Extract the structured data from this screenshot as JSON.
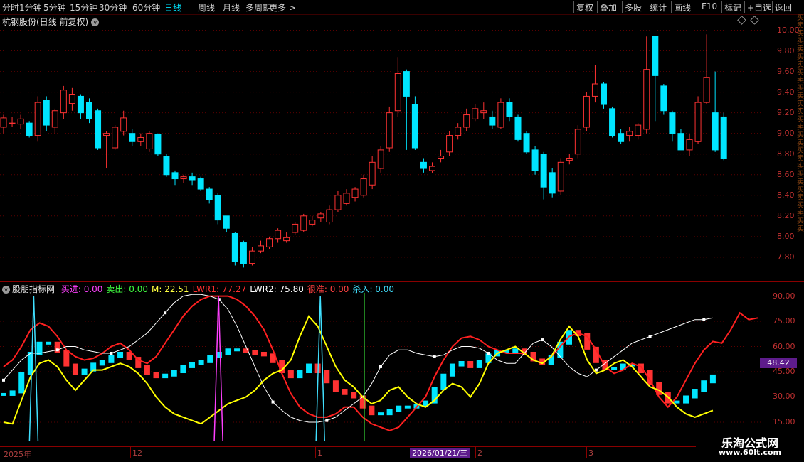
{
  "periods": [
    {
      "label": "分时",
      "active": false
    },
    {
      "label": "1分钟",
      "active": false
    },
    {
      "label": "5分钟",
      "active": false
    },
    {
      "label": "15分钟",
      "active": false
    },
    {
      "label": "30分钟",
      "active": false
    },
    {
      "label": "60分钟",
      "active": false
    },
    {
      "label": "日线",
      "active": true
    },
    {
      "label": "周线",
      "active": false
    },
    {
      "label": "月线",
      "active": false
    },
    {
      "label": "多周期",
      "active": false
    },
    {
      "label": "更多 >",
      "active": false
    }
  ],
  "toolbar": [
    "复权",
    "叠加",
    "多股",
    "统计",
    "画线",
    "F10",
    "标记",
    "+自选",
    "返回"
  ],
  "stock": {
    "title": "杭钢股份(日线 前复权)"
  },
  "price_axis": {
    "ticks": [
      "10.00",
      "9.80",
      "9.60",
      "9.40",
      "9.20",
      "9.00",
      "8.80",
      "8.60",
      "8.40",
      "8.20",
      "8.00",
      "7.80"
    ],
    "ylim": [
      7.62,
      10.1
    ]
  },
  "indicator": {
    "name": "股朋指标网",
    "items": [
      {
        "label": "买进: 0.00",
        "color": "#ff40ff"
      },
      {
        "label": "卖出: 0.00",
        "color": "#40ff40"
      },
      {
        "label": "M: 22.51",
        "color": "#ffff40"
      },
      {
        "label": "LWR1: 77.27",
        "color": "#ff3030"
      },
      {
        "label": "LWR2: 75.80",
        "color": "#ffffff"
      },
      {
        "label": "很准: 0.00",
        "color": "#ff4040"
      },
      {
        "label": "杀入: 0.00",
        "color": "#40e0ff"
      }
    ],
    "ticks": [
      "90.00",
      "75.00",
      "60.00",
      "45.00",
      "30.00",
      "15.00"
    ],
    "ylim": [
      4,
      97
    ],
    "current_value": "48.42"
  },
  "right_strip_text": "买卖实买卖买卖买卖买卖实实买卖买卖买卖实买卖买卖买卖买卖",
  "dates": [
    {
      "label": "2025年"
    },
    {
      "label": "12"
    },
    {
      "label": "1"
    },
    {
      "label": "2"
    },
    {
      "label": "3"
    }
  ],
  "cursor_date": "2026/01/21/三",
  "watermark": {
    "line1": "乐淘公式网",
    "line2": "www.60lt.com"
  },
  "colors": {
    "up": "#ff3232",
    "down": "#00e5ff",
    "lwr1": "#ff2020",
    "lwr2": "#ffffff",
    "m": "#ffff00",
    "buy": "#ff40ff",
    "kill": "#40e0ff",
    "grid": "#5a0000"
  },
  "chart_data": [
    {
      "type": "candlestick",
      "title": "杭钢股份(日线 前复权)",
      "x": [
        "d01",
        "d02",
        "d03",
        "d04",
        "d05",
        "d06",
        "d07",
        "d08",
        "d09",
        "d10",
        "d11",
        "d12",
        "d13",
        "d14",
        "d15",
        "d16",
        "d17",
        "d18",
        "d19",
        "d20",
        "d21",
        "d22",
        "d23",
        "d24",
        "d25",
        "d26",
        "d27",
        "d28",
        "d29",
        "d30",
        "d31",
        "d32",
        "d33",
        "d34",
        "d35",
        "d36",
        "d37",
        "d38",
        "d39",
        "d40",
        "d41",
        "d42",
        "d43",
        "d44",
        "d45",
        "d46",
        "d47",
        "d48",
        "d49",
        "d50",
        "d51",
        "d52",
        "d53",
        "d54",
        "d55",
        "d56",
        "d57",
        "d58",
        "d59",
        "d60",
        "d61",
        "d62",
        "d63",
        "d64",
        "d65",
        "d66",
        "d67",
        "d68",
        "d69",
        "d70",
        "d71",
        "d72",
        "d73",
        "d74",
        "d75",
        "d76",
        "d77",
        "d78",
        "d79",
        "d80",
        "d81",
        "d82",
        "d83",
        "d84",
        "d85"
      ],
      "open": [
        9.06,
        9.1,
        9.09,
        9.1,
        8.98,
        9.32,
        9.06,
        9.2,
        9.29,
        9.36,
        9.3,
        9.22,
        8.98,
        8.86,
        9.02,
        9.0,
        8.92,
        8.85,
        8.99,
        8.78,
        8.62,
        8.56,
        8.58,
        8.56,
        8.46,
        8.4,
        8.2,
        8.03,
        7.94,
        7.74,
        7.86,
        7.9,
        7.98,
        7.96,
        8.04,
        8.06,
        8.12,
        8.18,
        8.14,
        8.26,
        8.32,
        8.38,
        8.4,
        8.5,
        8.66,
        8.86,
        9.22,
        9.6,
        9.28,
        8.72,
        8.64,
        8.76,
        8.82,
        8.98,
        9.06,
        9.14,
        9.2,
        9.16,
        9.06,
        9.3,
        9.16,
        9.0,
        8.84,
        8.8,
        8.62,
        8.44,
        8.74,
        8.8,
        9.06,
        9.36,
        9.48,
        9.24,
        9.0,
        8.98,
        8.98,
        9.04,
        9.94,
        9.46,
        9.2,
        9.0,
        8.84,
        8.92,
        9.3,
        9.2,
        9.16
      ],
      "close": [
        9.15,
        9.1,
        9.14,
        8.98,
        9.3,
        9.08,
        9.22,
        9.42,
        9.38,
        9.2,
        9.14,
        8.86,
        9.0,
        9.06,
        9.15,
        8.92,
        8.96,
        9.0,
        8.8,
        8.6,
        8.56,
        8.58,
        8.55,
        8.46,
        8.36,
        8.16,
        8.08,
        7.76,
        7.74,
        7.86,
        7.91,
        7.98,
        8.06,
        7.99,
        8.12,
        8.2,
        8.16,
        8.22,
        8.26,
        8.4,
        8.42,
        8.46,
        8.56,
        8.72,
        8.84,
        9.2,
        9.58,
        9.36,
        8.86,
        8.66,
        8.68,
        8.78,
        8.98,
        9.06,
        9.18,
        9.24,
        9.22,
        9.08,
        9.3,
        9.16,
        8.94,
        8.82,
        8.64,
        8.48,
        8.42,
        8.72,
        8.76,
        9.04,
        9.36,
        9.48,
        9.28,
        8.98,
        8.92,
        9.02,
        9.08,
        9.62,
        9.56,
        9.22,
        9.0,
        8.84,
        8.94,
        9.3,
        9.54,
        8.84,
        8.76
      ],
      "high": [
        9.18,
        9.16,
        9.18,
        9.12,
        9.36,
        9.36,
        9.24,
        9.46,
        9.44,
        9.38,
        9.34,
        9.24,
        9.02,
        9.08,
        9.22,
        9.04,
        9.0,
        9.02,
        9.0,
        8.8,
        8.64,
        8.6,
        8.62,
        8.58,
        8.48,
        8.42,
        8.2,
        8.04,
        7.96,
        7.9,
        7.96,
        8.0,
        8.08,
        8.04,
        8.14,
        8.22,
        8.2,
        8.24,
        8.3,
        8.44,
        8.46,
        8.48,
        8.6,
        8.78,
        8.88,
        9.26,
        9.74,
        9.62,
        9.36,
        8.76,
        8.72,
        8.84,
        9.02,
        9.1,
        9.24,
        9.28,
        9.3,
        9.22,
        9.34,
        9.34,
        9.18,
        9.02,
        8.88,
        8.82,
        8.66,
        8.76,
        8.8,
        9.08,
        9.4,
        9.66,
        9.5,
        9.26,
        9.04,
        9.06,
        9.1,
        9.94,
        9.6,
        9.48,
        9.22,
        9.04,
        9.0,
        9.36,
        9.96,
        9.6,
        9.2
      ],
      "low": [
        9.0,
        9.06,
        9.04,
        8.96,
        8.92,
        9.02,
        9.0,
        9.14,
        9.22,
        9.14,
        9.1,
        8.84,
        8.66,
        8.84,
        8.98,
        8.88,
        8.88,
        8.82,
        8.78,
        8.58,
        8.5,
        8.52,
        8.5,
        8.44,
        8.32,
        8.12,
        8.04,
        7.72,
        7.7,
        7.72,
        7.84,
        7.88,
        7.94,
        7.94,
        8.02,
        8.04,
        8.1,
        8.14,
        8.12,
        8.24,
        8.3,
        8.34,
        8.38,
        8.46,
        8.62,
        8.82,
        9.16,
        8.84,
        8.84,
        8.62,
        8.62,
        8.72,
        8.78,
        8.94,
        9.02,
        9.12,
        9.14,
        9.04,
        9.04,
        9.12,
        8.92,
        8.8,
        8.6,
        8.36,
        8.38,
        8.4,
        8.7,
        8.76,
        9.02,
        9.3,
        9.24,
        8.96,
        8.9,
        8.92,
        8.94,
        9.0,
        9.12,
        9.18,
        8.92,
        8.84,
        8.78,
        8.9,
        9.28,
        8.82,
        8.74
      ]
    },
    {
      "type": "line",
      "title": "股朋指标网",
      "x_count": 85,
      "series": [
        {
          "name": "LWR1",
          "values": [
            48,
            52,
            60,
            70,
            74,
            72,
            66,
            58,
            54,
            52,
            53,
            56,
            60,
            62,
            58,
            52,
            50,
            54,
            62,
            70,
            78,
            84,
            88,
            90,
            90,
            90,
            88,
            84,
            78,
            70,
            58,
            44,
            32,
            24,
            20,
            18,
            18,
            20,
            24,
            24,
            18,
            14,
            12,
            10,
            12,
            18,
            24,
            30,
            42,
            52,
            60,
            65,
            66,
            64,
            60,
            58,
            56,
            56,
            56,
            52,
            50,
            54,
            60,
            66,
            68,
            66,
            58,
            48,
            44,
            46,
            50,
            48,
            40,
            30,
            24,
            30,
            40,
            50,
            58,
            63,
            62,
            70,
            80,
            76,
            77
          ]
        },
        {
          "name": "LWR2",
          "values": [
            40,
            46,
            52,
            56,
            56,
            57,
            58,
            60,
            60,
            58,
            57,
            56,
            56,
            58,
            60,
            64,
            68,
            74,
            80,
            86,
            90,
            91,
            91,
            90,
            88,
            82,
            72,
            60,
            48,
            36,
            27,
            22,
            18,
            16,
            15,
            15,
            16,
            18,
            22,
            26,
            30,
            38,
            48,
            55,
            58,
            58,
            56,
            55,
            54,
            55,
            58,
            60,
            60,
            59,
            56,
            52,
            50,
            50,
            56,
            62,
            64,
            60,
            54,
            48,
            44,
            42,
            46,
            50,
            54,
            58,
            62,
            64,
            66,
            68,
            70,
            72,
            74,
            76,
            76,
            77
          ]
        },
        {
          "name": "M",
          "values": [
            15,
            14,
            28,
            42,
            50,
            52,
            48,
            40,
            34,
            40,
            46,
            46,
            48,
            50,
            48,
            44,
            38,
            30,
            24,
            20,
            18,
            16,
            14,
            18,
            22,
            26,
            28,
            30,
            34,
            40,
            44,
            46,
            52,
            66,
            78,
            72,
            60,
            48,
            40,
            36,
            30,
            26,
            28,
            34,
            36,
            30,
            26,
            24,
            28,
            34,
            38,
            36,
            30,
            38,
            50,
            56,
            58,
            60,
            56,
            52,
            50,
            54,
            64,
            72,
            66,
            52,
            44,
            46,
            50,
            52,
            48,
            42,
            36,
            34,
            30,
            24,
            20,
            18,
            20,
            22
          ]
        }
      ],
      "ylim": [
        4,
        97
      ]
    }
  ]
}
